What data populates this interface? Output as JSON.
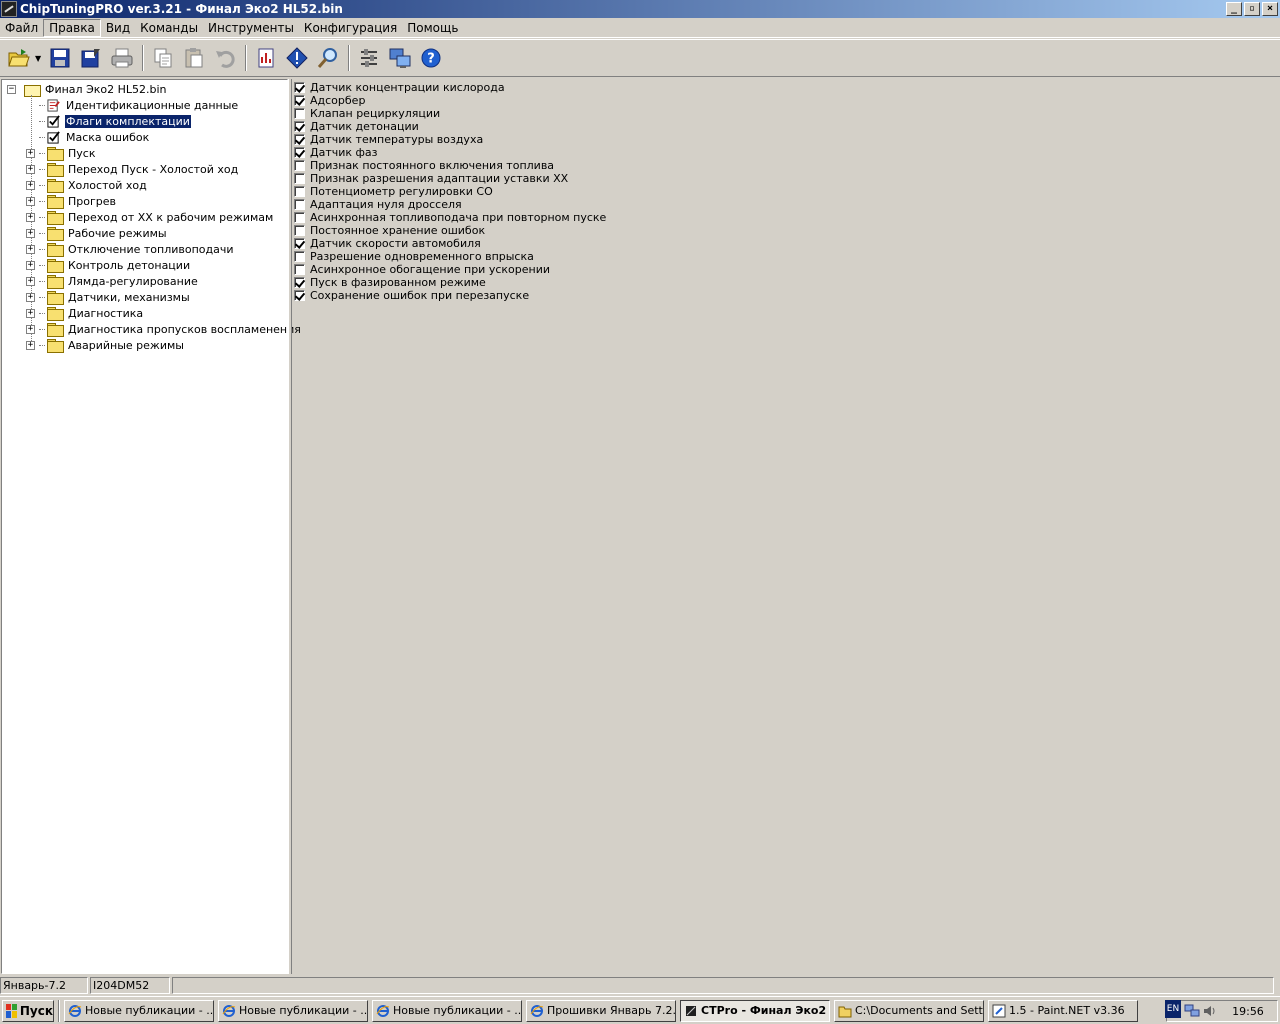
{
  "window": {
    "title": "ChipTuningPRO ver.3.21 - Финал Эко2 HL52.bin",
    "buttons": [
      "_",
      "▫",
      "×"
    ]
  },
  "menu": [
    "Файл",
    "Правка",
    "Вид",
    "Команды",
    "Инструменты",
    "Конфигурация",
    "Помощь"
  ],
  "menu_active": "Правка",
  "toolbar": [
    "open-folder-icon",
    "save-icon",
    "save-as-icon",
    "print-icon",
    "copy-icon",
    "paste-icon",
    "undo-icon",
    "report-icon",
    "info-icon",
    "search-icon",
    "tools-icon",
    "transfer-icon",
    "help-icon"
  ],
  "tree": {
    "root": "Финал Эко2 HL52.bin",
    "items": [
      {
        "label": "Идентификационные данные",
        "icon": "document-icon",
        "expander": false
      },
      {
        "label": "Флаги комплектации",
        "icon": "checkbox-icon",
        "expander": false,
        "selected": true
      },
      {
        "label": "Маска ошибок",
        "icon": "checkbox-icon",
        "expander": false
      },
      {
        "label": "Пуск",
        "icon": "folder-icon",
        "expander": true
      },
      {
        "label": "Переход Пуск - Холостой ход",
        "icon": "folder-icon",
        "expander": true
      },
      {
        "label": "Холостой ход",
        "icon": "folder-icon",
        "expander": true
      },
      {
        "label": "Прогрев",
        "icon": "folder-icon",
        "expander": true
      },
      {
        "label": "Переход от ХХ к рабочим режимам",
        "icon": "folder-icon",
        "expander": true
      },
      {
        "label": "Рабочие режимы",
        "icon": "folder-icon",
        "expander": true
      },
      {
        "label": "Отключение топливоподачи",
        "icon": "folder-icon",
        "expander": true
      },
      {
        "label": "Контроль детонации",
        "icon": "folder-icon",
        "expander": true
      },
      {
        "label": "Лямда-регулирование",
        "icon": "folder-icon",
        "expander": true
      },
      {
        "label": "Датчики, механизмы",
        "icon": "folder-icon",
        "expander": true
      },
      {
        "label": "Диагностика",
        "icon": "folder-icon",
        "expander": true
      },
      {
        "label": "Диагностика пропусков воспламенения",
        "icon": "folder-icon",
        "expander": true
      },
      {
        "label": "Аварийные режимы",
        "icon": "folder-icon",
        "expander": true
      }
    ]
  },
  "flags": [
    {
      "label": "Датчик концентрации кислорода",
      "checked": true
    },
    {
      "label": "Адсорбер",
      "checked": true
    },
    {
      "label": "Клапан рециркуляции",
      "checked": false
    },
    {
      "label": "Датчик детонации",
      "checked": true
    },
    {
      "label": "Датчик температуры воздуха",
      "checked": true
    },
    {
      "label": "Датчик фаз",
      "checked": true
    },
    {
      "label": "Признак постоянного включения топлива",
      "checked": false
    },
    {
      "label": "Признак разрешения адаптации уставки ХХ",
      "checked": false
    },
    {
      "label": "Потенциометр регулировки СО",
      "checked": false
    },
    {
      "label": "Адаптация нуля дросселя",
      "checked": false
    },
    {
      "label": "Асинхронная топливоподача при повторном пуске",
      "checked": false
    },
    {
      "label": "Постоянное хранение ошибок",
      "checked": false
    },
    {
      "label": "Датчик скорости автомобиля",
      "checked": true
    },
    {
      "label": "Разрешение одновременного впрыска",
      "checked": false
    },
    {
      "label": "Асинхронное обогащение при ускорении",
      "checked": false
    },
    {
      "label": "Пуск в фазированном режиме",
      "checked": true
    },
    {
      "label": "Сохранение ошибок при перезапуске",
      "checked": true
    }
  ],
  "status": [
    "Январь-7.2",
    "I204DM52",
    ""
  ],
  "taskbar": {
    "start": "Пуск",
    "tasks": [
      {
        "label": "Новые публикации - ...",
        "icon": "ie-icon"
      },
      {
        "label": "Новые публикации - ...",
        "icon": "ie-icon"
      },
      {
        "label": "Новые публикации - ...",
        "icon": "ie-icon"
      },
      {
        "label": "Прошивки Январь 7.2...",
        "icon": "ie-icon"
      },
      {
        "label": "CTPro - Финал Эко2 ...",
        "icon": "chip-icon",
        "active": true
      },
      {
        "label": "C:\\Documents and Sett...",
        "icon": "folder-icon"
      },
      {
        "label": "1.5 - Paint.NET v3.36",
        "icon": "paint-icon"
      }
    ],
    "lang": "EN",
    "chevron": "«",
    "clock": "19:56"
  }
}
